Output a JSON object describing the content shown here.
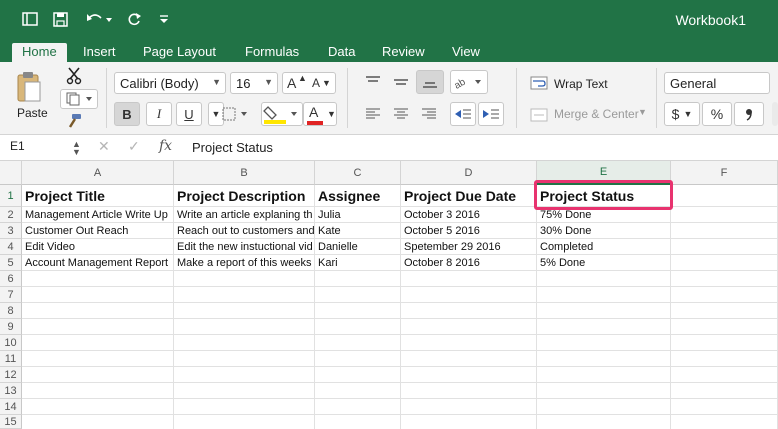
{
  "window": {
    "title": "Workbook1"
  },
  "tabs": [
    "Home",
    "Insert",
    "Page Layout",
    "Formulas",
    "Data",
    "Review",
    "View"
  ],
  "ribbon": {
    "paste_label": "Paste",
    "font_name": "Calibri (Body)",
    "font_size": "16",
    "wrap_text": "Wrap Text",
    "merge_center": "Merge & Center",
    "number_format": "General",
    "bold": "B",
    "italic": "I",
    "underline": "U",
    "currency": "$",
    "percent": "%",
    "grow_font": "A",
    "shrink_font": "A",
    "font_color_letter": "A",
    "highlight_color": "#ffe600",
    "font_color": "#e02424"
  },
  "formula_bar": {
    "name_box": "E1",
    "fx": "fx",
    "value": "Project Status"
  },
  "columns": [
    "A",
    "B",
    "C",
    "D",
    "E",
    "F"
  ],
  "rows": [
    "1",
    "2",
    "3",
    "4",
    "5",
    "6",
    "7",
    "8",
    "9",
    "10",
    "11",
    "12",
    "13",
    "14",
    "15"
  ],
  "cells": [
    [
      "Project Title",
      "Project Description",
      "Assignee",
      "Project Due Date",
      "Project Status"
    ],
    [
      "Management Article Write Up",
      "Write an article explaning th",
      "Julia",
      "October 3 2016",
      "75% Done"
    ],
    [
      "Customer Out Reach",
      "Reach out to customers and",
      "Kate",
      "October 5 2016",
      "30% Done"
    ],
    [
      "Edit Video",
      "Edit the new instuctional vid",
      "Danielle",
      "Spetember 29 2016",
      "Completed"
    ],
    [
      "Account Management Report",
      "Make a report of this weeks",
      "Kari",
      "October 8 2016",
      "5% Done"
    ]
  ],
  "colors": {
    "brand": "#217346",
    "highlight_border": "#e8336f"
  }
}
